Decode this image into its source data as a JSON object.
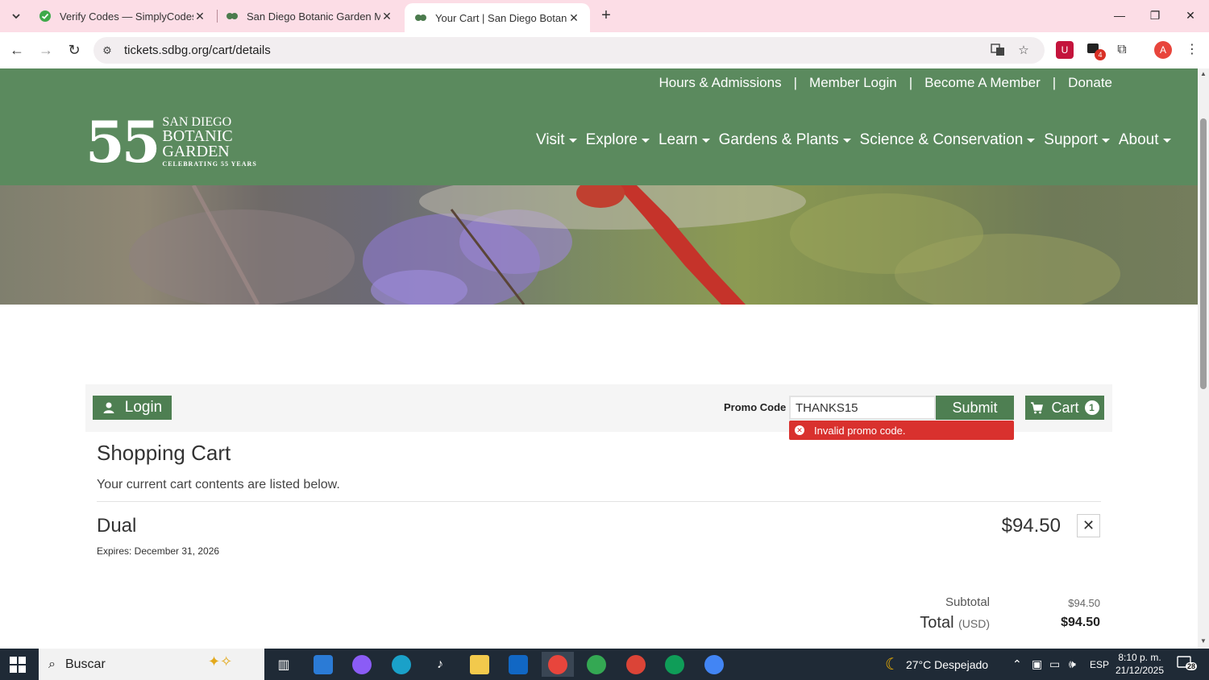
{
  "browser": {
    "tabs": [
      {
        "title": "Verify Codes — SimplyCodes",
        "active": false
      },
      {
        "title": "San Diego Botanic Garden Men",
        "active": false
      },
      {
        "title": "Your Cart | San Diego Botanic G",
        "active": true
      }
    ],
    "url": "tickets.sdbg.org/cart/details",
    "extension_badge": "4",
    "profile_initial": "A"
  },
  "site": {
    "utility_links": [
      "Hours & Admissions",
      "Member Login",
      "Become A Member",
      "Donate"
    ],
    "utility_separator": "|",
    "logo": {
      "number": "55",
      "line1": "SAN DIEGO",
      "line2": "BOTANIC",
      "line3": "GARDEN",
      "tagline": "CELEBRATING 55 YEARS"
    },
    "nav": [
      "Visit",
      "Explore",
      "Learn",
      "Gardens & Plants",
      "Science & Conservation",
      "Support",
      "About"
    ]
  },
  "cartbar": {
    "login_label": "Login",
    "promo_label": "Promo Code",
    "promo_value": "THANKS15",
    "submit_label": "Submit",
    "cart_label": "Cart",
    "cart_count": "1",
    "error_message": "Invalid promo code."
  },
  "cart": {
    "title": "Shopping Cart",
    "description": "Your current cart contents are listed below.",
    "item": {
      "name": "Dual",
      "expires": "Expires: December 31, 2026",
      "price": "$94.50",
      "remove_glyph": "✕"
    },
    "subtotal_label": "Subtotal",
    "subtotal_value": "$94.50",
    "total_label": "Total",
    "total_currency": "(USD)",
    "total_value": "$94.50"
  },
  "taskbar": {
    "search_placeholder": "Buscar",
    "weather": "27°C Despejado",
    "language": "ESP",
    "time": "8:10 p. m.",
    "date": "21/12/2025",
    "notification_count": "28"
  },
  "colors": {
    "brand_green": "#5b8a5e",
    "button_green": "#4e7f52",
    "error_red": "#d9312e",
    "tab_strip": "#fcdde6"
  }
}
